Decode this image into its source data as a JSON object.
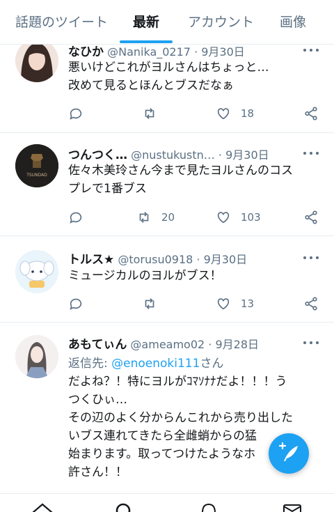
{
  "tabs": [
    {
      "label": "話題のツイート",
      "active": false
    },
    {
      "label": "最新",
      "active": true
    },
    {
      "label": "アカウント",
      "active": false
    },
    {
      "label": "画像",
      "active": false
    }
  ],
  "tweets": [
    {
      "name": "なひか",
      "handle": "@Nanika_0217",
      "date": "9月30日",
      "line1": "悪いけどこれがヨルさんはちょっと…",
      "line2": "改めて見るとほんとブスだなぁ",
      "replies": "",
      "retweets": "",
      "likes": "18"
    },
    {
      "name": "つんつく…",
      "handle": "@nustukustn…",
      "date": "9月30日",
      "avatar_text": "TSUNDAD",
      "line1": "佐々木美玲さん今まで見たヨルさんのコス",
      "line2": "プレで1番ブス",
      "replies": "",
      "retweets": "20",
      "likes": "103"
    },
    {
      "name": "トルス★",
      "handle": "@torusu0918",
      "date": "9月30日",
      "line1": "ミュージカルのヨルがブス！",
      "replies": "",
      "retweets": "",
      "likes": "13"
    },
    {
      "name": "あもてぃん",
      "handle": "@ameamo02",
      "date": "9月28日",
      "reply_prefix": "返信先: ",
      "reply_mention": "@enoenoki111",
      "reply_suffix": "さん",
      "line1": "だよね？！特にヨルがｺﾏｿﾅﾅだよ！！！う",
      "line2": "つくひぃ…",
      "line3": "その辺のよく分からんこれから売り出した",
      "line4": "いブス連れてきたら全雌蛸からの猛",
      "line5": "始まります。取ってつけたようなホ",
      "line6": "許さん！！"
    }
  ],
  "fab": {
    "icon": "compose-icon"
  },
  "colors": {
    "accent": "#1da1f2",
    "muted": "#5b7083",
    "text": "#14171a"
  }
}
